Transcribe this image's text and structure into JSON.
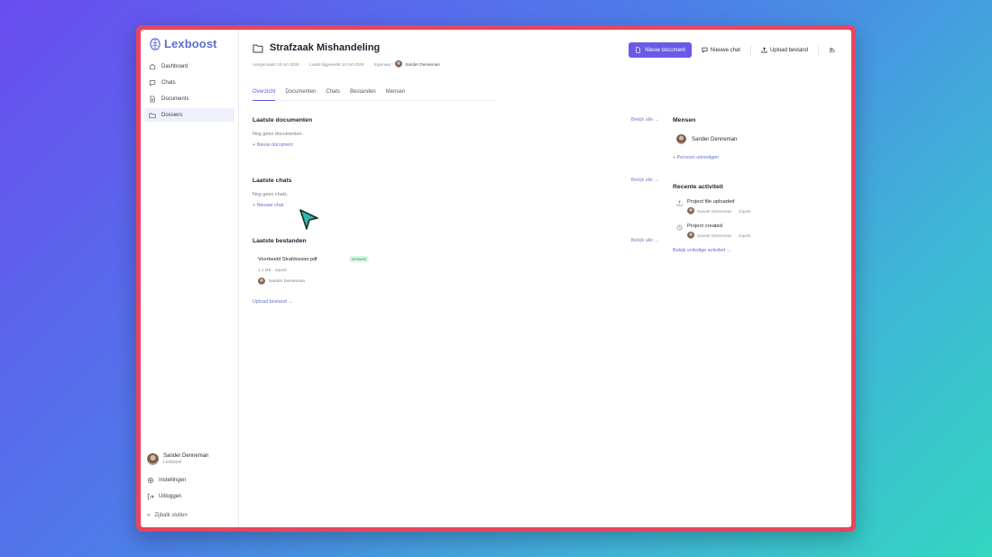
{
  "brand": {
    "name": "Lexboost"
  },
  "sidebar": {
    "items": [
      {
        "label": "Dashboard",
        "icon": "home-icon"
      },
      {
        "label": "Chats",
        "icon": "chat-icon"
      },
      {
        "label": "Documents",
        "icon": "document-icon"
      },
      {
        "label": "Dossiers",
        "icon": "folder-icon",
        "active": true
      }
    ],
    "user": {
      "name": "Sander Denneman",
      "org": "Lexboost"
    },
    "settings_label": "Instellingen",
    "logout_label": "Uitloggen",
    "collapse_label": "Zijbalk sluiten"
  },
  "header": {
    "title": "Strafzaak Mishandeling",
    "created": "Aangemaakt 10 mrt 2026",
    "updated": "Laatst bijgewerkt 10 mrt 2026",
    "owner_label": "Eigenaar",
    "owner_name": "Sander Denneman"
  },
  "actions": {
    "new_document": "Nieuw document",
    "new_chat": "Nieuwe chat",
    "upload_file": "Upload bestand"
  },
  "tabs": [
    "Overzicht",
    "Documenten",
    "Chats",
    "Bestanden",
    "Mensen"
  ],
  "sections": {
    "documents": {
      "title": "Laatste documenten",
      "see_all": "Bekijk alle →",
      "empty": "Nog geen documenten.",
      "add": "+ Nieuw document"
    },
    "chats": {
      "title": "Laatste chats",
      "see_all": "Bekijk alle →",
      "empty": "Nog geen chats.",
      "add": "+ Nieuwe chat"
    },
    "files": {
      "title": "Laatste bestanden",
      "see_all": "Bekijk alle →",
      "file": {
        "name": "Voorbeeld Strafdossier.pdf",
        "badge": "Verwerkt",
        "size": "2.1 MB",
        "time": "zojuist",
        "owner": "Sander Denneman"
      },
      "upload": "Upload bestand →"
    }
  },
  "people": {
    "title": "Mensen",
    "person": "Sander Denneman",
    "invite": "+ Persoon uitnodigen"
  },
  "activity": {
    "title": "Recente activiteit",
    "items": [
      {
        "title": "Project file uploaded",
        "user": "Sander Denneman",
        "time": "zojuist"
      },
      {
        "title": "Project created",
        "user": "Sander Denneman",
        "time": "zojuist"
      }
    ],
    "see_all": "Bekijk volledige activiteit →"
  },
  "colors": {
    "accent": "#6a5ae6",
    "frame": "#e8455e",
    "link": "#6a6fd0",
    "badge_bg": "#dcf6e7"
  }
}
